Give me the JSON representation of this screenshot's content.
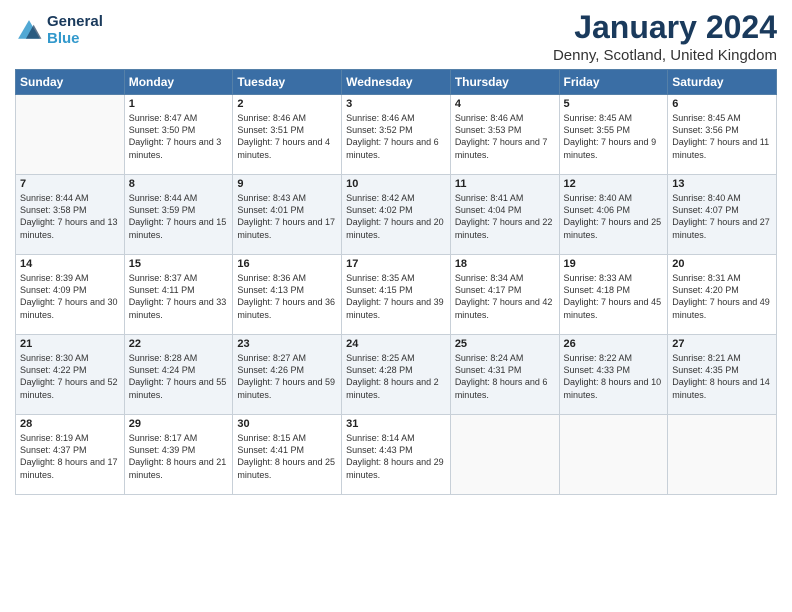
{
  "header": {
    "logo_general": "General",
    "logo_blue": "Blue",
    "title": "January 2024",
    "location": "Denny, Scotland, United Kingdom"
  },
  "days_of_week": [
    "Sunday",
    "Monday",
    "Tuesday",
    "Wednesday",
    "Thursday",
    "Friday",
    "Saturday"
  ],
  "weeks": [
    [
      {
        "day": "",
        "sunrise": "",
        "sunset": "",
        "daylight": ""
      },
      {
        "day": "1",
        "sunrise": "Sunrise: 8:47 AM",
        "sunset": "Sunset: 3:50 PM",
        "daylight": "Daylight: 7 hours and 3 minutes."
      },
      {
        "day": "2",
        "sunrise": "Sunrise: 8:46 AM",
        "sunset": "Sunset: 3:51 PM",
        "daylight": "Daylight: 7 hours and 4 minutes."
      },
      {
        "day": "3",
        "sunrise": "Sunrise: 8:46 AM",
        "sunset": "Sunset: 3:52 PM",
        "daylight": "Daylight: 7 hours and 6 minutes."
      },
      {
        "day": "4",
        "sunrise": "Sunrise: 8:46 AM",
        "sunset": "Sunset: 3:53 PM",
        "daylight": "Daylight: 7 hours and 7 minutes."
      },
      {
        "day": "5",
        "sunrise": "Sunrise: 8:45 AM",
        "sunset": "Sunset: 3:55 PM",
        "daylight": "Daylight: 7 hours and 9 minutes."
      },
      {
        "day": "6",
        "sunrise": "Sunrise: 8:45 AM",
        "sunset": "Sunset: 3:56 PM",
        "daylight": "Daylight: 7 hours and 11 minutes."
      }
    ],
    [
      {
        "day": "7",
        "sunrise": "Sunrise: 8:44 AM",
        "sunset": "Sunset: 3:58 PM",
        "daylight": "Daylight: 7 hours and 13 minutes."
      },
      {
        "day": "8",
        "sunrise": "Sunrise: 8:44 AM",
        "sunset": "Sunset: 3:59 PM",
        "daylight": "Daylight: 7 hours and 15 minutes."
      },
      {
        "day": "9",
        "sunrise": "Sunrise: 8:43 AM",
        "sunset": "Sunset: 4:01 PM",
        "daylight": "Daylight: 7 hours and 17 minutes."
      },
      {
        "day": "10",
        "sunrise": "Sunrise: 8:42 AM",
        "sunset": "Sunset: 4:02 PM",
        "daylight": "Daylight: 7 hours and 20 minutes."
      },
      {
        "day": "11",
        "sunrise": "Sunrise: 8:41 AM",
        "sunset": "Sunset: 4:04 PM",
        "daylight": "Daylight: 7 hours and 22 minutes."
      },
      {
        "day": "12",
        "sunrise": "Sunrise: 8:40 AM",
        "sunset": "Sunset: 4:06 PM",
        "daylight": "Daylight: 7 hours and 25 minutes."
      },
      {
        "day": "13",
        "sunrise": "Sunrise: 8:40 AM",
        "sunset": "Sunset: 4:07 PM",
        "daylight": "Daylight: 7 hours and 27 minutes."
      }
    ],
    [
      {
        "day": "14",
        "sunrise": "Sunrise: 8:39 AM",
        "sunset": "Sunset: 4:09 PM",
        "daylight": "Daylight: 7 hours and 30 minutes."
      },
      {
        "day": "15",
        "sunrise": "Sunrise: 8:37 AM",
        "sunset": "Sunset: 4:11 PM",
        "daylight": "Daylight: 7 hours and 33 minutes."
      },
      {
        "day": "16",
        "sunrise": "Sunrise: 8:36 AM",
        "sunset": "Sunset: 4:13 PM",
        "daylight": "Daylight: 7 hours and 36 minutes."
      },
      {
        "day": "17",
        "sunrise": "Sunrise: 8:35 AM",
        "sunset": "Sunset: 4:15 PM",
        "daylight": "Daylight: 7 hours and 39 minutes."
      },
      {
        "day": "18",
        "sunrise": "Sunrise: 8:34 AM",
        "sunset": "Sunset: 4:17 PM",
        "daylight": "Daylight: 7 hours and 42 minutes."
      },
      {
        "day": "19",
        "sunrise": "Sunrise: 8:33 AM",
        "sunset": "Sunset: 4:18 PM",
        "daylight": "Daylight: 7 hours and 45 minutes."
      },
      {
        "day": "20",
        "sunrise": "Sunrise: 8:31 AM",
        "sunset": "Sunset: 4:20 PM",
        "daylight": "Daylight: 7 hours and 49 minutes."
      }
    ],
    [
      {
        "day": "21",
        "sunrise": "Sunrise: 8:30 AM",
        "sunset": "Sunset: 4:22 PM",
        "daylight": "Daylight: 7 hours and 52 minutes."
      },
      {
        "day": "22",
        "sunrise": "Sunrise: 8:28 AM",
        "sunset": "Sunset: 4:24 PM",
        "daylight": "Daylight: 7 hours and 55 minutes."
      },
      {
        "day": "23",
        "sunrise": "Sunrise: 8:27 AM",
        "sunset": "Sunset: 4:26 PM",
        "daylight": "Daylight: 7 hours and 59 minutes."
      },
      {
        "day": "24",
        "sunrise": "Sunrise: 8:25 AM",
        "sunset": "Sunset: 4:28 PM",
        "daylight": "Daylight: 8 hours and 2 minutes."
      },
      {
        "day": "25",
        "sunrise": "Sunrise: 8:24 AM",
        "sunset": "Sunset: 4:31 PM",
        "daylight": "Daylight: 8 hours and 6 minutes."
      },
      {
        "day": "26",
        "sunrise": "Sunrise: 8:22 AM",
        "sunset": "Sunset: 4:33 PM",
        "daylight": "Daylight: 8 hours and 10 minutes."
      },
      {
        "day": "27",
        "sunrise": "Sunrise: 8:21 AM",
        "sunset": "Sunset: 4:35 PM",
        "daylight": "Daylight: 8 hours and 14 minutes."
      }
    ],
    [
      {
        "day": "28",
        "sunrise": "Sunrise: 8:19 AM",
        "sunset": "Sunset: 4:37 PM",
        "daylight": "Daylight: 8 hours and 17 minutes."
      },
      {
        "day": "29",
        "sunrise": "Sunrise: 8:17 AM",
        "sunset": "Sunset: 4:39 PM",
        "daylight": "Daylight: 8 hours and 21 minutes."
      },
      {
        "day": "30",
        "sunrise": "Sunrise: 8:15 AM",
        "sunset": "Sunset: 4:41 PM",
        "daylight": "Daylight: 8 hours and 25 minutes."
      },
      {
        "day": "31",
        "sunrise": "Sunrise: 8:14 AM",
        "sunset": "Sunset: 4:43 PM",
        "daylight": "Daylight: 8 hours and 29 minutes."
      },
      {
        "day": "",
        "sunrise": "",
        "sunset": "",
        "daylight": ""
      },
      {
        "day": "",
        "sunrise": "",
        "sunset": "",
        "daylight": ""
      },
      {
        "day": "",
        "sunrise": "",
        "sunset": "",
        "daylight": ""
      }
    ]
  ]
}
